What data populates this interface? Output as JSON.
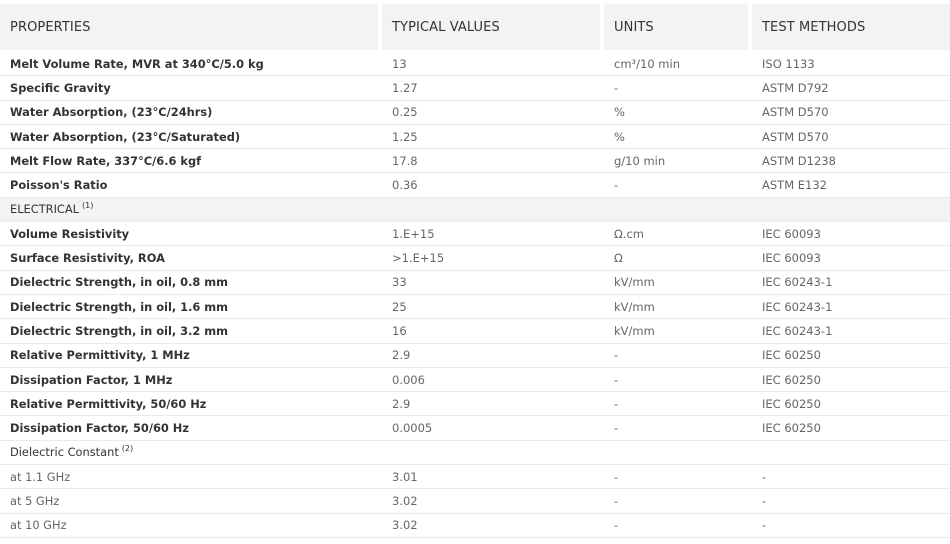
{
  "columns": [
    "PROPERTIES",
    "TYPICAL VALUES",
    "UNITS",
    "TEST METHODS"
  ],
  "rows": [
    {
      "type": "data",
      "property": "Melt Volume Rate, MVR at 340°C/5.0 kg",
      "value": "13",
      "unit": "cm³/10 min",
      "method": "ISO 1133"
    },
    {
      "type": "data",
      "property": "Specific Gravity",
      "value": "1.27",
      "unit": "-",
      "method": "ASTM D792"
    },
    {
      "type": "data",
      "property": "Water Absorption, (23°C/24hrs)",
      "value": "0.25",
      "unit": "%",
      "method": "ASTM D570"
    },
    {
      "type": "data",
      "property": "Water Absorption, (23°C/Saturated)",
      "value": "1.25",
      "unit": "%",
      "method": "ASTM D570"
    },
    {
      "type": "data",
      "property": "Melt Flow Rate, 337°C/6.6 kgf",
      "value": "17.8",
      "unit": "g/10 min",
      "method": "ASTM D1238"
    },
    {
      "type": "data",
      "property": "Poisson's Ratio",
      "value": "0.36",
      "unit": "-",
      "method": "ASTM E132"
    },
    {
      "type": "section",
      "property": "ELECTRICAL",
      "note": "(1)"
    },
    {
      "type": "data",
      "property": "Volume Resistivity",
      "value": "1.E+15",
      "unit": "Ω.cm",
      "method": "IEC 60093"
    },
    {
      "type": "data",
      "property": "Surface Resistivity, ROA",
      "value": ">1.E+15",
      "unit": "Ω",
      "method": "IEC 60093"
    },
    {
      "type": "data",
      "property": "Dielectric Strength, in oil, 0.8 mm",
      "value": "33",
      "unit": "kV/mm",
      "method": "IEC 60243-1"
    },
    {
      "type": "data",
      "property": "Dielectric Strength, in oil, 1.6 mm",
      "value": "25",
      "unit": "kV/mm",
      "method": "IEC 60243-1"
    },
    {
      "type": "data",
      "property": "Dielectric Strength, in oil, 3.2 mm",
      "value": "16",
      "unit": "kV/mm",
      "method": "IEC 60243-1"
    },
    {
      "type": "data",
      "property": "Relative Permittivity, 1 MHz",
      "value": "2.9",
      "unit": "-",
      "method": "IEC 60250"
    },
    {
      "type": "data",
      "property": "Dissipation Factor, 1 MHz",
      "value": "0.006",
      "unit": "-",
      "method": "IEC 60250"
    },
    {
      "type": "data",
      "property": "Relative Permittivity, 50/60 Hz",
      "value": "2.9",
      "unit": "-",
      "method": "IEC 60250"
    },
    {
      "type": "data",
      "property": "Dissipation Factor, 50/60 Hz",
      "value": "0.0005",
      "unit": "-",
      "method": "IEC 60250"
    },
    {
      "type": "subsection",
      "property": "Dielectric Constant",
      "note": "(2)"
    },
    {
      "type": "sub",
      "property": "at 1.1 GHz",
      "value": "3.01",
      "unit": "-",
      "method": "-"
    },
    {
      "type": "sub",
      "property": "at 5 GHz",
      "value": "3.02",
      "unit": "-",
      "method": "-"
    },
    {
      "type": "sub",
      "property": "at 10 GHz",
      "value": "3.02",
      "unit": "-",
      "method": "-"
    }
  ]
}
